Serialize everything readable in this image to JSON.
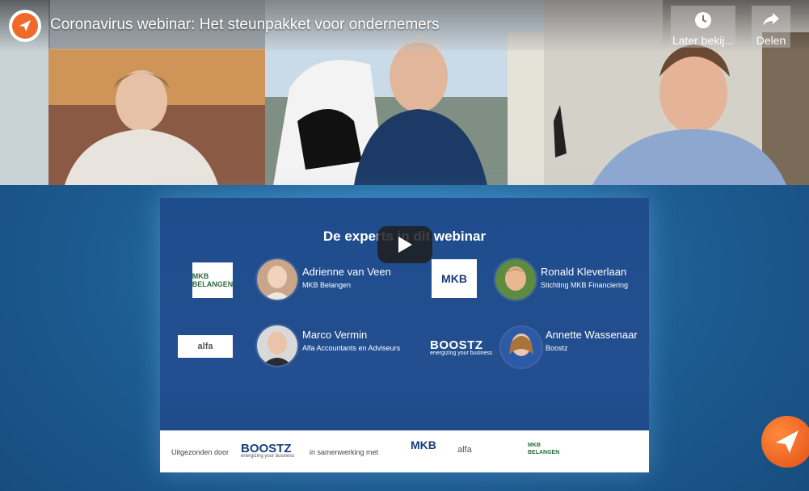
{
  "video": {
    "title": "Coronavirus webinar: Het steunpakket voor ondernemers"
  },
  "actions": {
    "watch_later_label": "Later bekij...",
    "share_label": "Delen"
  },
  "slide": {
    "title": "De experts in dit webinar",
    "experts": [
      {
        "name": "Adrienne van Veen",
        "org": "MKB Belangen",
        "logo": "MKB BELANGEN"
      },
      {
        "name": "Ronald Kleverlaan",
        "org": "Stichting MKB Financiering",
        "logo": "MKB"
      },
      {
        "name": "Marco Vermin",
        "org": "Alfa Accountants en Adviseurs",
        "logo": "alfa"
      },
      {
        "name": "Annette Wassenaar",
        "org": "Boostz",
        "logo": "BOOSTZ"
      }
    ],
    "boostz_tagline": "energizing your business",
    "footer": {
      "broadcast_by": "Uitgezonden door",
      "in_cooperation": "in samenwerking met"
    }
  },
  "colors": {
    "accent_orange": "#ef6a2a",
    "slide_blue": "#234f90"
  }
}
